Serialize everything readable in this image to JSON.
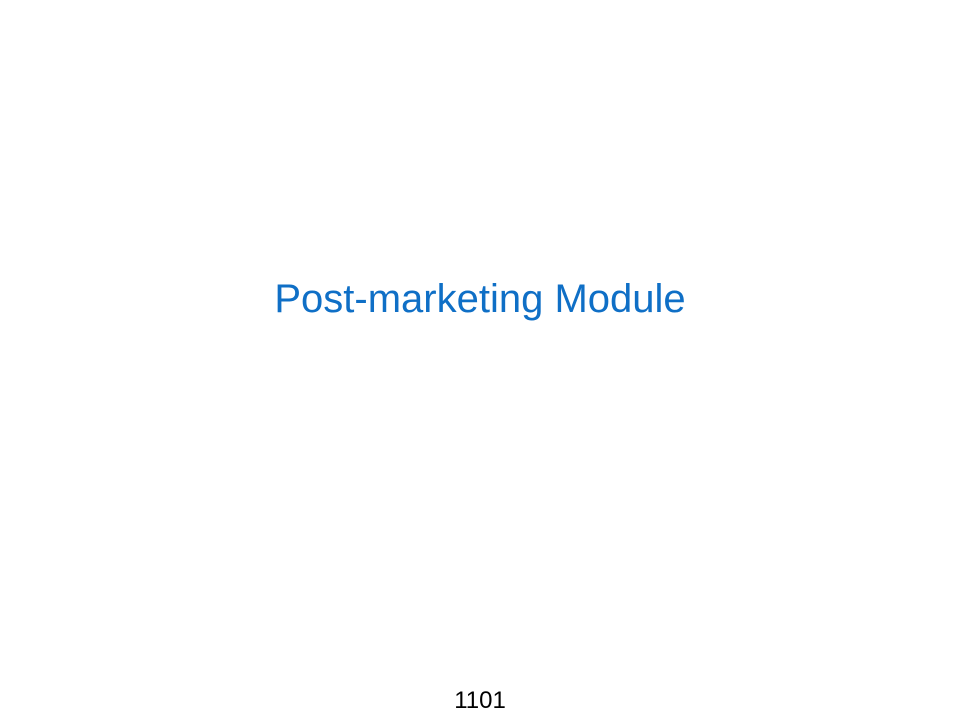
{
  "slide": {
    "title": "Post-marketing Module",
    "page_number": "1101",
    "title_color": "#0f6fc6",
    "background_color": "#ffffff"
  }
}
